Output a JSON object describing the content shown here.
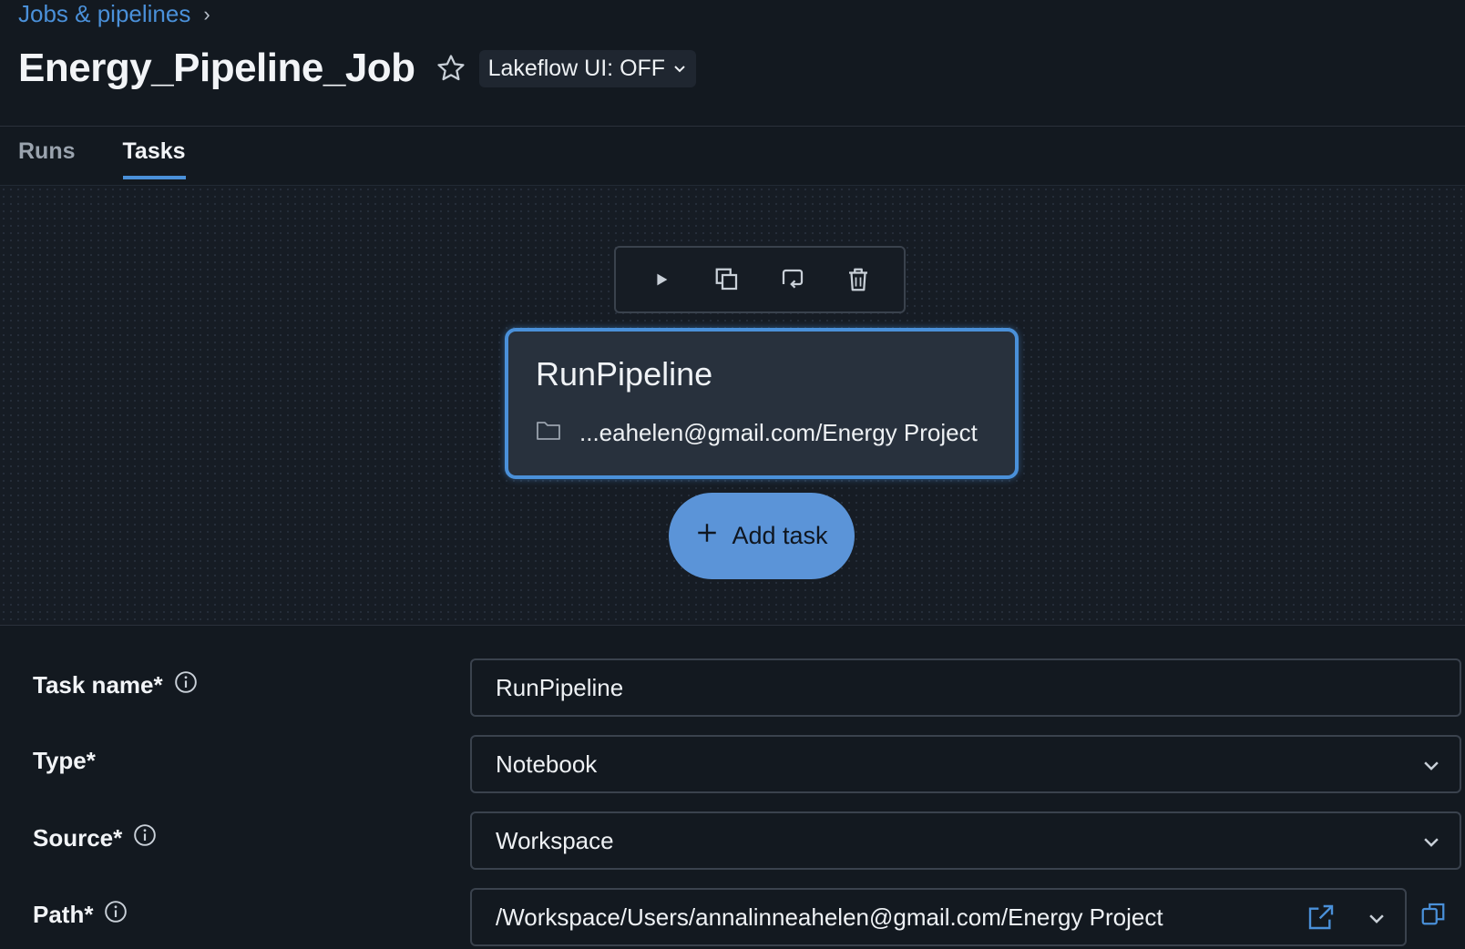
{
  "breadcrumb": {
    "parent": "Jobs & pipelines",
    "separator": "›"
  },
  "header": {
    "title": "Energy_Pipeline_Job",
    "lakeflow_toggle": "Lakeflow UI: OFF"
  },
  "tabs": [
    {
      "label": "Runs",
      "active": false
    },
    {
      "label": "Tasks",
      "active": true
    }
  ],
  "toolbar": {
    "icons": [
      "play-icon",
      "duplicate-icon",
      "repair-icon",
      "trash-icon"
    ]
  },
  "task_card": {
    "name": "RunPipeline",
    "path": "...eahelen@gmail.com/Energy Project"
  },
  "add_task": {
    "label": "Add task"
  },
  "form": {
    "task_name": {
      "label": "Task name*",
      "value": "RunPipeline"
    },
    "type": {
      "label": "Type*",
      "value": "Notebook"
    },
    "source": {
      "label": "Source*",
      "value": "Workspace"
    },
    "path": {
      "label": "Path*",
      "value": "/Workspace/Users/annalinneahelen@gmail.com/Energy Project"
    }
  },
  "colors": {
    "accent": "#4a90d9",
    "background": "#131920",
    "card": "#28313d",
    "add_button": "#5b94d8"
  }
}
